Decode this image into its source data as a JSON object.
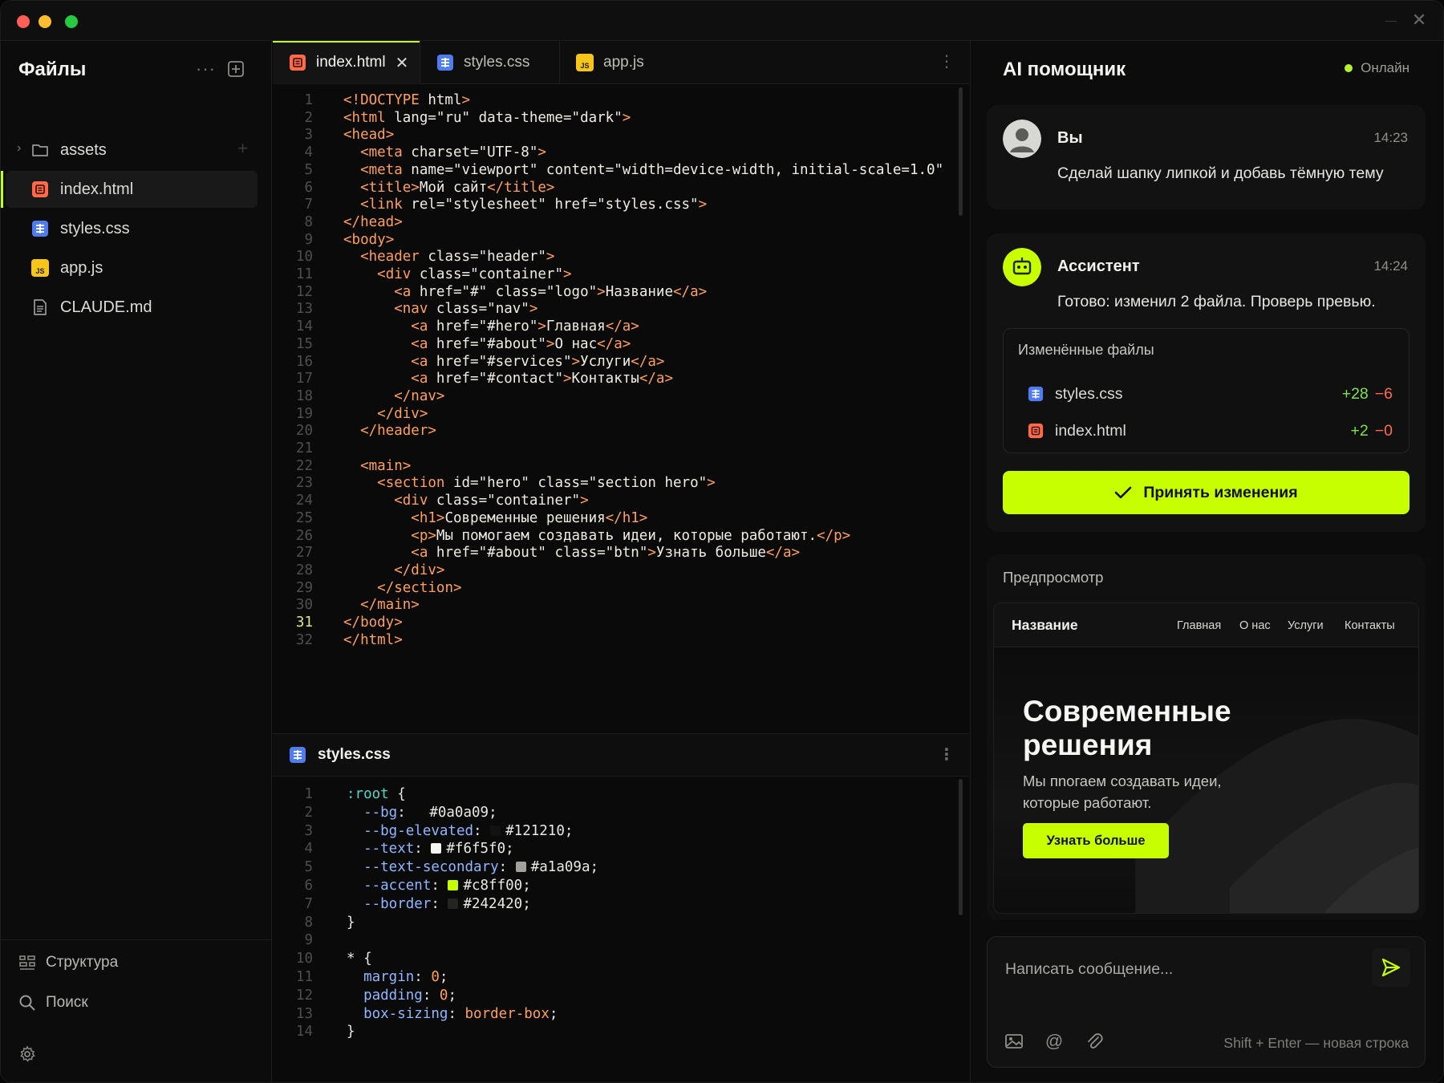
{
  "sidebar": {
    "title": "Файлы",
    "more": "···",
    "files": [
      {
        "label": "assets",
        "icon": "folder-icon",
        "kind": "folder"
      },
      {
        "label": "index.html",
        "icon": "html-file-icon",
        "kind": "html",
        "active": true
      },
      {
        "label": "styles.css",
        "icon": "css-file-icon",
        "kind": "css"
      },
      {
        "label": "app.js",
        "icon": "js-file-icon",
        "kind": "js"
      },
      {
        "label": "CLAUDE.md",
        "icon": "markdown-file-icon",
        "kind": "md"
      }
    ],
    "bottom": {
      "structure": "Структура",
      "search": "Поиск"
    }
  },
  "editor": {
    "tabs": [
      {
        "label": "index.html",
        "active": true,
        "close": "✕"
      },
      {
        "label": "styles.css"
      },
      {
        "label": "app.js"
      }
    ],
    "js_badge": "JS",
    "current_line": 31,
    "html_lines": [
      "<!DOCTYPE html>",
      "<html lang=\"ru\" data-theme=\"dark\">",
      "<head>",
      "  <meta charset=\"UTF-8\">",
      "  <meta name=\"viewport\" content=\"width=device-width, initial-scale=1.0\"",
      "  <title>Мой сайт</title>",
      "  <link rel=\"stylesheet\" href=\"styles.css\">",
      "</head>",
      "<body>",
      "  <header class=\"header\">",
      "    <div class=\"container\">",
      "      <a href=\"#\" class=\"logo\">Название</a>",
      "      <nav class=\"nav\">",
      "        <a href=\"#hero\">Главная</a>",
      "        <a href=\"#about\">О нас</a>",
      "        <a href=\"#services\">Услуги</a>",
      "        <a href=\"#contact\">Контакты</a>",
      "      </nav>",
      "    </div>",
      "  </header>",
      "",
      "  <main>",
      "    <section id=\"hero\" class=\"section hero\">",
      "      <div class=\"container\">",
      "        <h1>Современные решения</h1>",
      "        <p>Мы помогаем создавать идеи, которые работают.</p>",
      "        <a href=\"#about\" class=\"btn\">Узнать больше</a>",
      "      </div>",
      "    </section>",
      "  </main>",
      "</body>",
      "</html>"
    ],
    "css_panel_title": "styles.css",
    "css_lines": [
      {
        "t": "sel",
        "text": ":root {"
      },
      {
        "t": "var",
        "prop": "--bg",
        "color": "#0a0a09",
        "value": "#0a0a09;"
      },
      {
        "t": "var",
        "prop": "--bg-elevated",
        "color": "#121210",
        "value": "#121210;"
      },
      {
        "t": "var",
        "prop": "--text",
        "color": "#f6f5f0",
        "value": "#f6f5f0;"
      },
      {
        "t": "var",
        "prop": "--text-secondary",
        "color": "#a1a09a",
        "value": "#a1a09a;"
      },
      {
        "t": "var",
        "prop": "--accent",
        "color": "#c8ff00",
        "value": "#c8ff00;"
      },
      {
        "t": "var",
        "prop": "--border",
        "color": "#242420",
        "value": "#242420;"
      },
      {
        "t": "plain",
        "text": "}"
      },
      {
        "t": "plain",
        "text": ""
      },
      {
        "t": "plain",
        "text": "* {"
      },
      {
        "t": "decl",
        "prop": "margin",
        "value": "0",
        "end": ";"
      },
      {
        "t": "decl",
        "prop": "padding",
        "value": "0",
        "end": ";"
      },
      {
        "t": "decl",
        "prop": "box-sizing",
        "value": "border-box",
        "end": ";"
      },
      {
        "t": "plain",
        "text": "}"
      }
    ]
  },
  "ai": {
    "title": "AI помощник",
    "status": "Онлайн",
    "user_msg": {
      "name": "Вы",
      "time": "14:23",
      "text": "Сделай шапку липкой и добавь тёмную тему"
    },
    "assistant_msg": {
      "name": "Ассистент",
      "time": "14:24",
      "text": "Готово: изменил 2 файла. Проверь превью."
    },
    "changed_title": "Изменённые файлы",
    "changed_files": [
      {
        "name": "styles.css",
        "add": "+28",
        "del": "−6"
      },
      {
        "name": "index.html",
        "add": "+2",
        "del": "−0"
      }
    ],
    "accept_label": "Принять изменения",
    "preview_title": "Предпросмотр",
    "preview": {
      "logo": "Название",
      "nav": [
        "Главная",
        "О нас",
        "Услуги",
        "Контакты"
      ],
      "h1": "Современные решения",
      "p": "Мы пnогаем создавать идеи, которые работают.",
      "btn": "Узнать больше"
    },
    "composer": {
      "placeholder": "Написать сообщение...",
      "hint": "Shift + Enter — новая строка"
    }
  },
  "colors": {
    "accent": "#c8ff00",
    "bg": "#0c0c0c",
    "add": "#7fe04a",
    "del": "#ff6a4a",
    "online": "#b4f22d"
  }
}
